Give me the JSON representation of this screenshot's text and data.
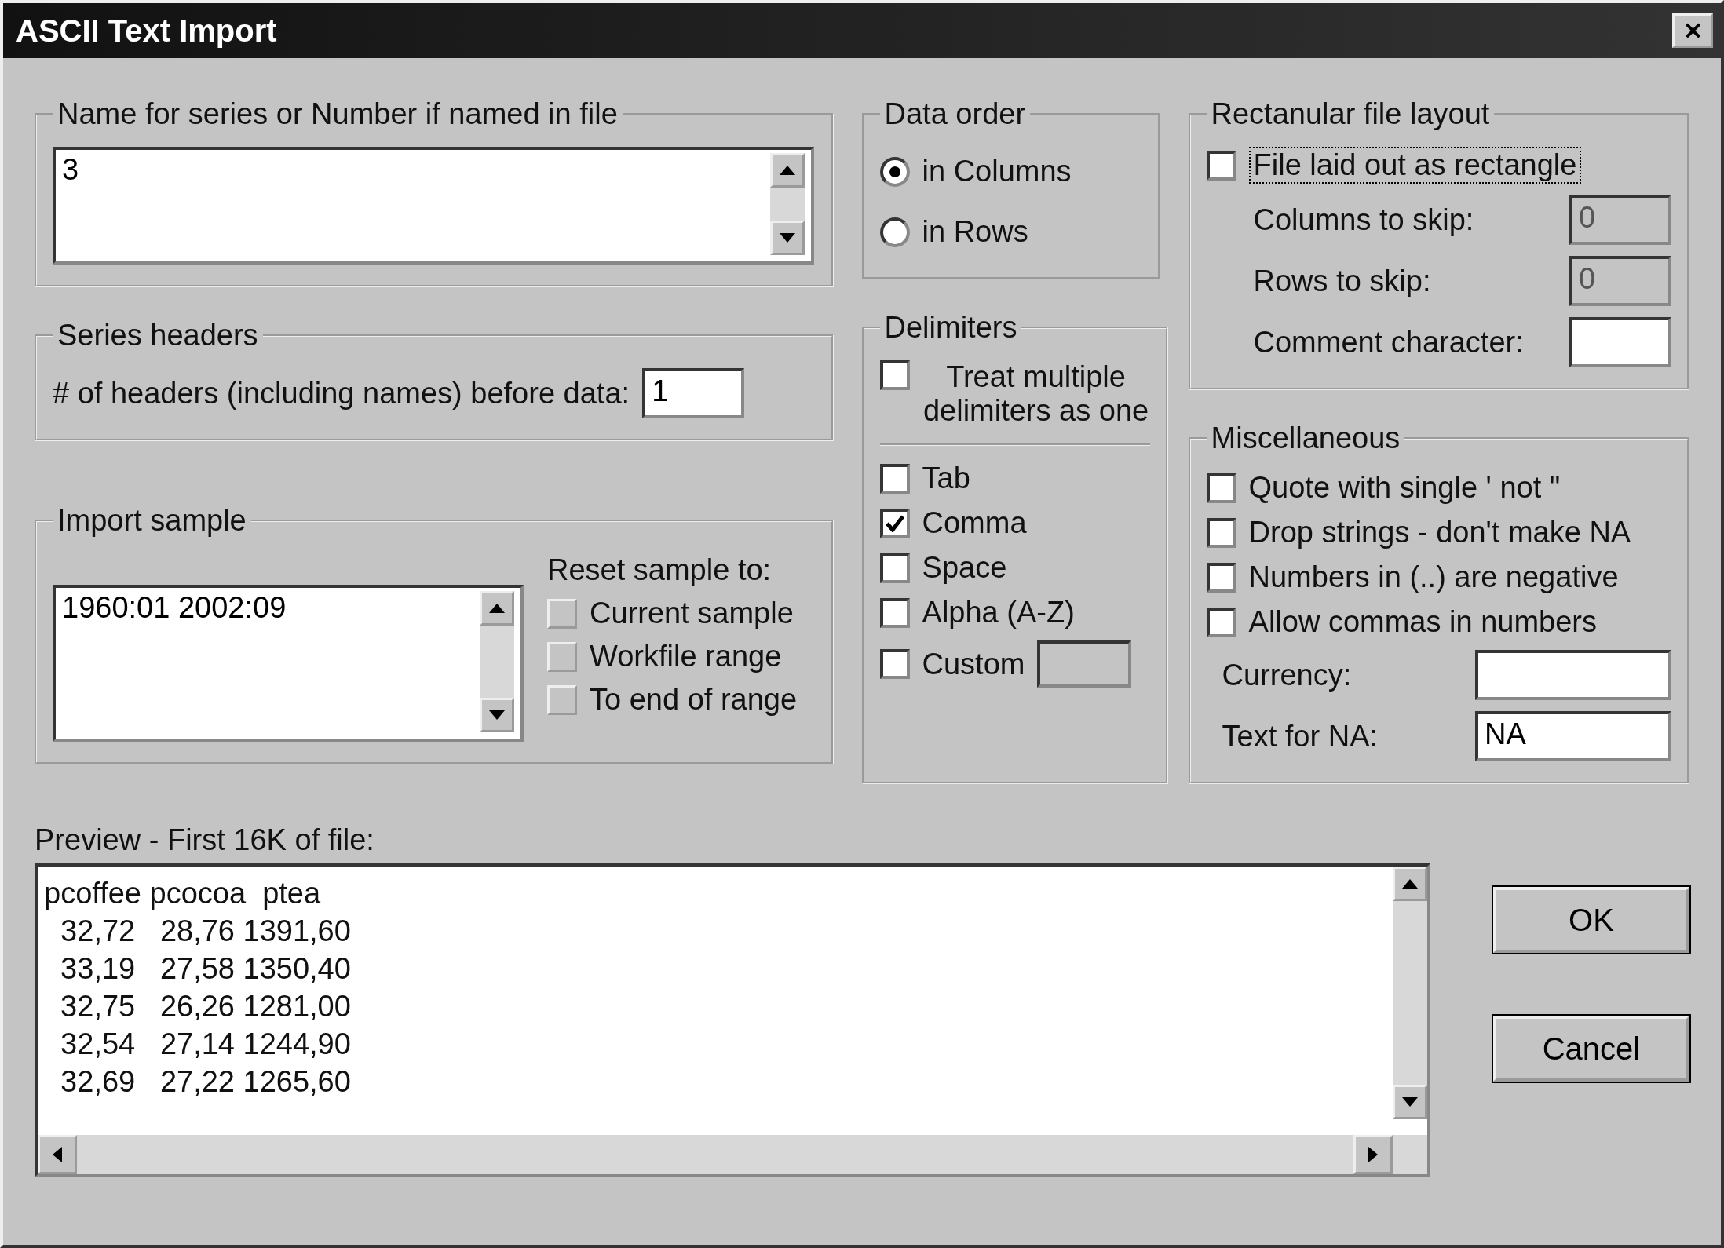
{
  "window": {
    "title": "ASCII Text Import",
    "close": "✕"
  },
  "series_name": {
    "label": "Name for series or Number if named in file",
    "value": "3"
  },
  "data_order": {
    "label": "Data order",
    "options": [
      {
        "label": "in Columns",
        "selected": true
      },
      {
        "label": "in Rows",
        "selected": false
      }
    ]
  },
  "rect_layout": {
    "label": "Rectanular file layout",
    "checkbox": {
      "label": "File laid out as rectangle",
      "checked": false,
      "focused": true
    },
    "fields": [
      {
        "label": "Columns to skip:",
        "value": "0",
        "disabled": true
      },
      {
        "label": "Rows to skip:",
        "value": "0",
        "disabled": true
      },
      {
        "label": "Comment character:",
        "disabled": false
      }
    ]
  },
  "series_headers": {
    "label": "Series headers",
    "field_label": "# of headers (including names) before data:",
    "value": "1"
  },
  "delimiters": {
    "label": "Delimiters",
    "multiple": {
      "label": "Treat multiple delimiters as one",
      "checked": false
    },
    "options": [
      {
        "label": "Tab",
        "checked": false
      },
      {
        "label": "Comma",
        "checked": true
      },
      {
        "label": "Space",
        "checked": false
      },
      {
        "label": "Alpha (A-Z)",
        "checked": false
      },
      {
        "label": "Custom",
        "checked": false,
        "kind": "field"
      }
    ]
  },
  "misc": {
    "label": "Miscellaneous",
    "options": [
      {
        "label": "Quote with single ' not \"",
        "checked": false
      },
      {
        "label": "Drop strings - don't make NA",
        "checked": false
      },
      {
        "label": "Numbers in (..) are negative",
        "checked": false
      },
      {
        "label": "Allow commas in numbers",
        "checked": false
      }
    ],
    "fields": [
      {
        "label": "Currency:"
      },
      {
        "label": "Text for NA:",
        "value": "NA"
      }
    ]
  },
  "import_sample": {
    "label": "Import sample",
    "value": "1960:01 2002:09",
    "reset_label": "Reset sample to:",
    "buttons": [
      "Current sample",
      "Workfile range",
      "To end of range"
    ]
  },
  "preview": {
    "label": "Preview -  First 16K of file:",
    "lines": [
      "pcoffee pcocoa  ptea",
      "  32,72   28,76 1391,60",
      "  33,19   27,58 1350,40",
      "  32,75   26,26 1281,00",
      "  32,54   27,14 1244,90",
      "  32,69   27,22 1265,60"
    ]
  },
  "buttons": [
    "OK",
    "Cancel"
  ]
}
